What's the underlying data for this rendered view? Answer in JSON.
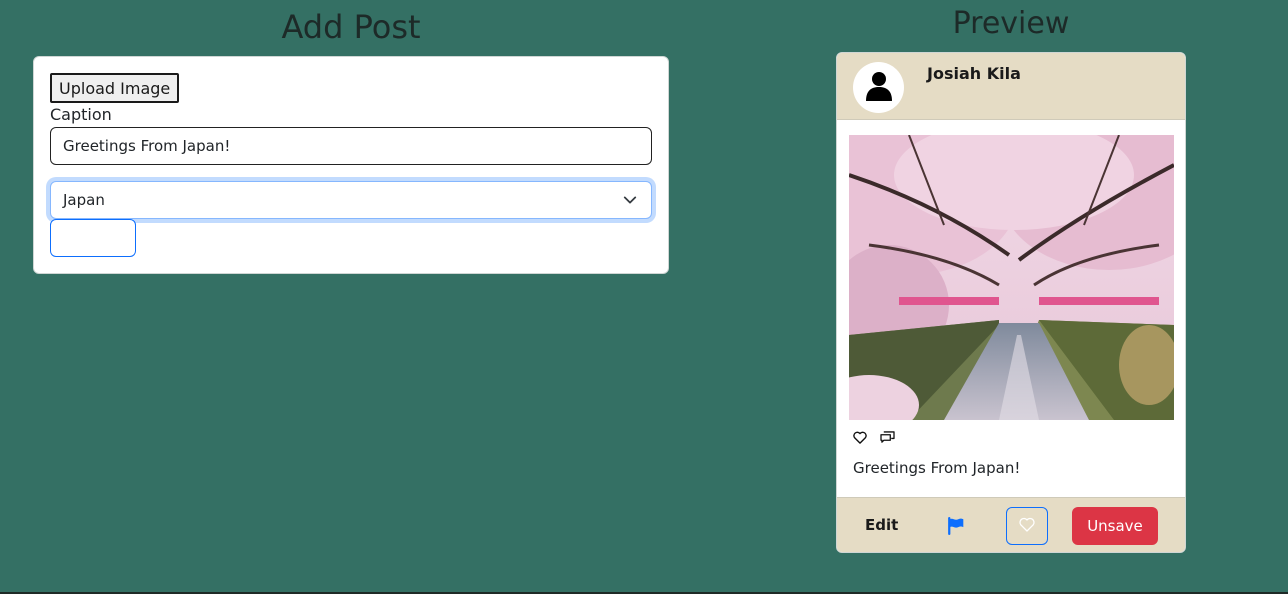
{
  "add_post": {
    "title": "Add Post",
    "upload_label": "Upload Image",
    "caption_label": "Caption",
    "caption_value": "Greetings From Japan!",
    "country_selected": "Japan"
  },
  "preview": {
    "title": "Preview",
    "author": "Josiah Kila",
    "caption": "Greetings From Japan!",
    "edit_label": "Edit",
    "unsave_label": "Unsave"
  },
  "icons": {
    "avatar": "person-icon",
    "like": "heart-icon",
    "comment": "comment-icon",
    "flag": "flag-icon",
    "select": "chevron-down-icon"
  },
  "colors": {
    "background": "#347064",
    "card_header": "#e5dcc5",
    "unsave": "#dc3545",
    "primary": "#0d6efd"
  }
}
